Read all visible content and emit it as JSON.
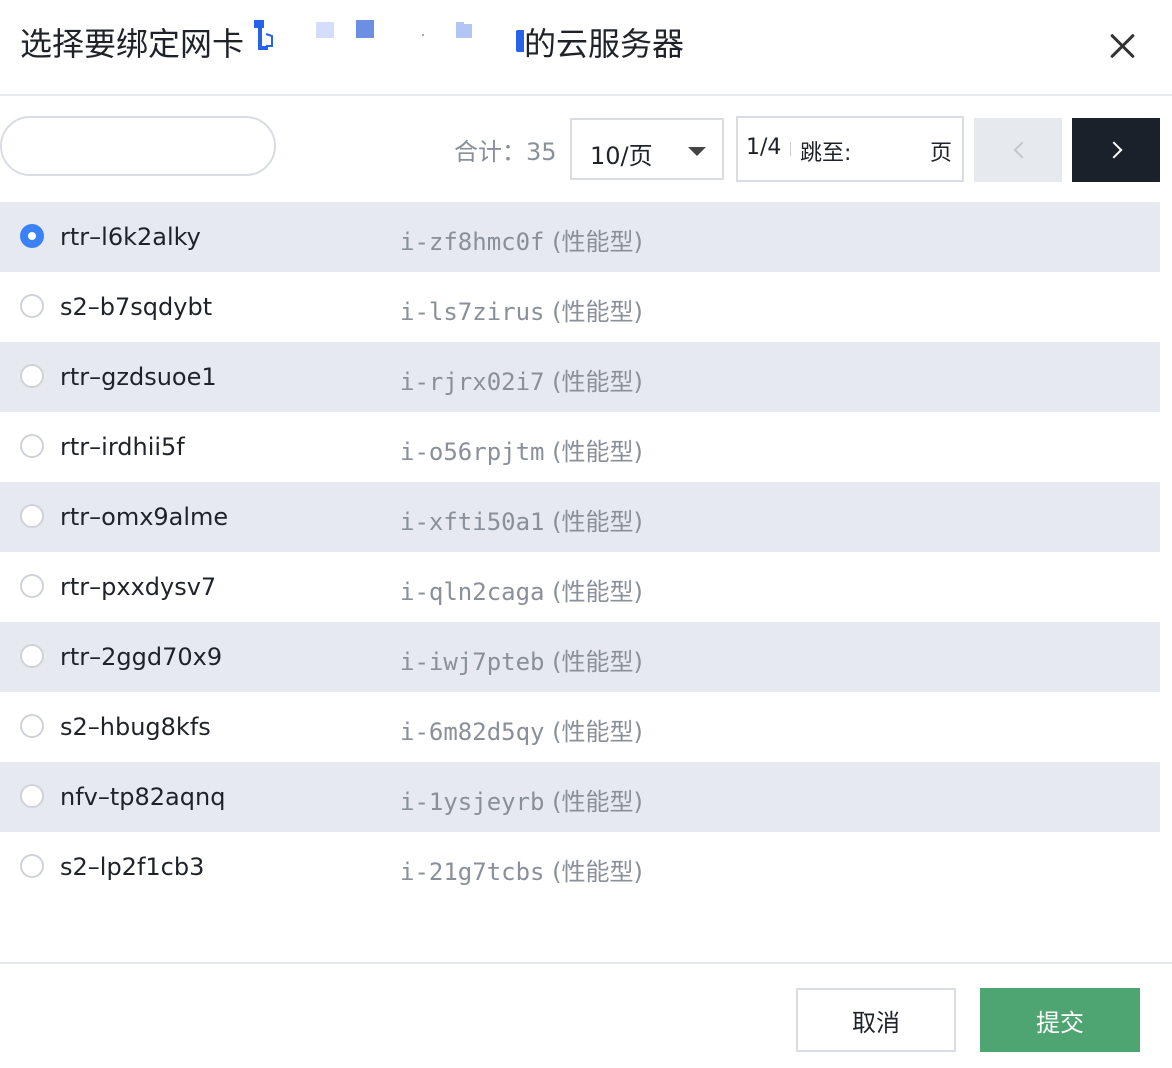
{
  "dialog": {
    "title_prefix": "选择要绑定网卡",
    "title_suffix": "的云服务器",
    "close_icon": "close-icon"
  },
  "toolbar": {
    "search_placeholder": "",
    "total": "合计：35",
    "page_size": "10/页",
    "page_indicator": "1/4",
    "jump_label": "跳至:",
    "page_unit": "页",
    "prev_icon": "chevron-left-icon",
    "next_icon": "chevron-right-icon"
  },
  "rows": [
    {
      "name": "rtr–l6k2alky",
      "instance": "i-zf8hmc0f",
      "type": " (性能型)",
      "selected": true
    },
    {
      "name": "s2–b7sqdybt",
      "instance": "i-ls7zirus",
      "type": " (性能型)",
      "selected": false
    },
    {
      "name": "rtr–gzdsuoe1",
      "instance": "i-rjrx02i7",
      "type": " (性能型)",
      "selected": false
    },
    {
      "name": "rtr–irdhii5f",
      "instance": "i-o56rpjtm",
      "type": " (性能型)",
      "selected": false
    },
    {
      "name": "rtr–omx9alme",
      "instance": "i-xfti50a1",
      "type": " (性能型)",
      "selected": false
    },
    {
      "name": "rtr–pxxdysv7",
      "instance": "i-qln2caga",
      "type": " (性能型)",
      "selected": false
    },
    {
      "name": "rtr–2ggd70x9",
      "instance": "i-iwj7pteb",
      "type": " (性能型)",
      "selected": false
    },
    {
      "name": "s2–hbug8kfs",
      "instance": "i-6m82d5qy",
      "type": " (性能型)",
      "selected": false
    },
    {
      "name": "nfv–tp82aqnq",
      "instance": "i-1ysjeyrb",
      "type": " (性能型)",
      "selected": false
    },
    {
      "name": "s2–lp2f1cb3",
      "instance": "i-21g7tcbs",
      "type": " (性能型)",
      "selected": false
    }
  ],
  "footer": {
    "cancel_label": "取消",
    "submit_label": "提交"
  },
  "colors": {
    "accent": "#3b82f6",
    "submit": "#4ea571",
    "next_button": "#1b212a",
    "row_alt": "#e6e9ef"
  }
}
